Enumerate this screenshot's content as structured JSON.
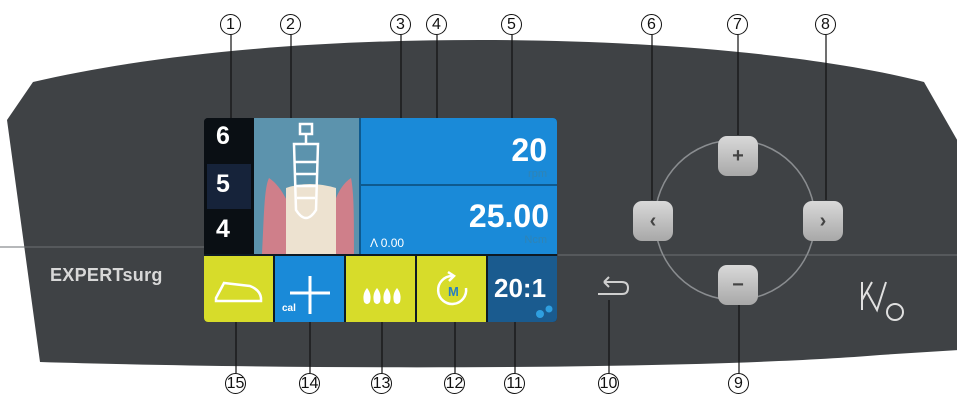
{
  "brand": "EXPERTsurg",
  "screen": {
    "speed_value": "20",
    "speed_unit": "rpm",
    "torque_value": "25.00",
    "torque_unit": "Ncm",
    "torque_reading": "Λ 0.00",
    "step_numbers": [
      "6",
      "5",
      "4"
    ],
    "ratio": "20:1",
    "cal_label": "cal",
    "motor_label": "M"
  },
  "buttons": {
    "plus": "+",
    "minus": "−",
    "left": "‹",
    "right": "›"
  },
  "callouts": [
    "1",
    "2",
    "3",
    "4",
    "5",
    "6",
    "7",
    "8",
    "9",
    "10",
    "11",
    "12",
    "13",
    "14",
    "15"
  ],
  "colors": {
    "housing": "#404346",
    "screen_blue": "#1a8ad8",
    "tile_yellow": "#d7dc2a",
    "unit_blue": "#2f84b5"
  }
}
